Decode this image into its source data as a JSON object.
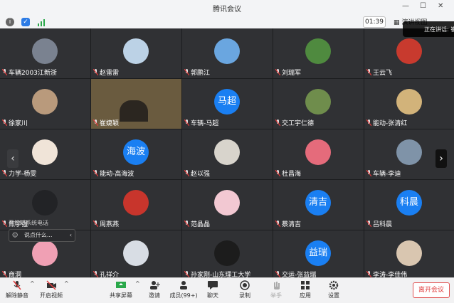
{
  "window": {
    "title": "腾讯会议"
  },
  "status": {
    "timer": "01:39",
    "view_label": "演讲视图",
    "speaking": "正在讲话: 崔"
  },
  "participants": [
    {
      "name": "车辆2003江新浙",
      "avatar": "photo",
      "color": "#7a8290"
    },
    {
      "name": "赵雷雷",
      "avatar": "photo",
      "color": "#bcd2e6"
    },
    {
      "name": "郭鹏江",
      "avatar": "photo",
      "color": "#6aa6e0"
    },
    {
      "name": "刘瑞军",
      "avatar": "photo",
      "color": "#4f8a3f"
    },
    {
      "name": "王云飞",
      "avatar": "photo",
      "color": "#c83a2e"
    },
    {
      "name": "徐家川",
      "avatar": "photo",
      "color": "#b99a7c"
    },
    {
      "name": "崔婕颖",
      "avatar": "video",
      "color": "#6a5b3f"
    },
    {
      "name": "车辆-马超",
      "avatar": "text",
      "text": "马超"
    },
    {
      "name": "交工宇仁德",
      "avatar": "photo",
      "color": "#6f8d4c"
    },
    {
      "name": "能动-张清红",
      "avatar": "photo",
      "color": "#d2b37a"
    },
    {
      "name": "力学-杨雯",
      "avatar": "photo",
      "color": "#f0e4d8"
    },
    {
      "name": "能动-高海波",
      "avatar": "text",
      "text": "海波"
    },
    {
      "name": "赵以强",
      "avatar": "photo",
      "color": "#d8d4cc"
    },
    {
      "name": "杜昌海",
      "avatar": "photo",
      "color": "#e56b7b"
    },
    {
      "name": "车辆-李迪",
      "avatar": "photo",
      "color": "#7f93a8"
    },
    {
      "name": "焦学强",
      "avatar": "photo",
      "color": "#222326"
    },
    {
      "name": "周燕燕",
      "avatar": "photo",
      "color": "#c8352c"
    },
    {
      "name": "范晶晶",
      "avatar": "photo",
      "color": "#f2c8d2"
    },
    {
      "name": "蔡清吉",
      "avatar": "text",
      "text": "清吉"
    },
    {
      "name": "吕科晨",
      "avatar": "text",
      "text": "科晨"
    },
    {
      "name": "商洞",
      "avatar": "photo",
      "color": "#f0a0b4"
    },
    {
      "name": "孔祥介",
      "avatar": "photo",
      "color": "#d8dde4"
    },
    {
      "name": "孙家刚-山东理工大学",
      "avatar": "photo",
      "color": "#1c1c1c"
    },
    {
      "name": "交运-张益瑞",
      "avatar": "text",
      "text": "益瑞"
    },
    {
      "name": "李涛-李佳伟",
      "avatar": "photo",
      "color": "#d9c6b0"
    }
  ],
  "overlays": {
    "phone_tip": "已接听系统电话",
    "chat_placeholder": "说点什么..."
  },
  "toolbar": {
    "mute": "解除静音",
    "video": "开启视频",
    "share": "共享屏幕",
    "invite": "邀请",
    "members": "成员(99+)",
    "chat": "聊天",
    "record": "录制",
    "raise_hand": "举手",
    "apps": "应用",
    "settings": "设置",
    "leave": "离开会议"
  },
  "colors": {
    "accent": "#1a7ff2",
    "leave": "#e03b3b",
    "tile": "#303134"
  }
}
